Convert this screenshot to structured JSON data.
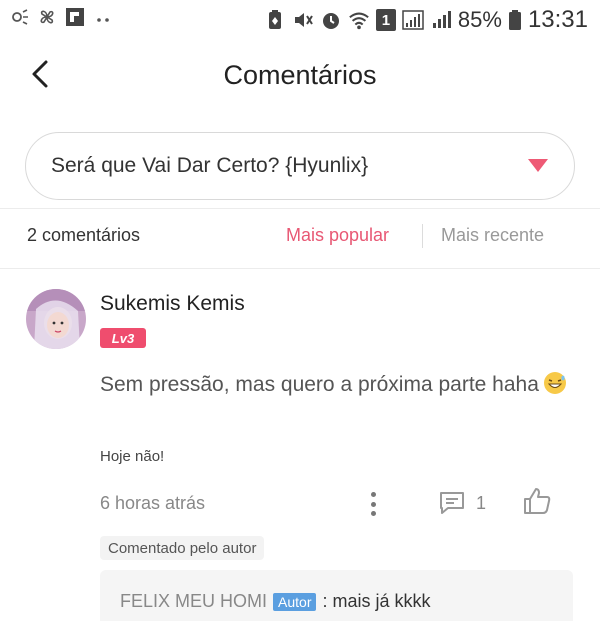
{
  "status_bar": {
    "battery_text": "85%",
    "time": "13:31",
    "sim_slot": "1",
    "icons_left": [
      "notification-icon",
      "pinwheel-icon",
      "flipboard-icon",
      "more-dots-icon"
    ],
    "icons_right": [
      "battery-saver-icon",
      "mute-icon",
      "alarm-icon",
      "wifi-icon",
      "sim-icon",
      "signal-icon",
      "signal-icon",
      "battery-icon"
    ]
  },
  "header": {
    "title": "Comentários",
    "back_icon": "back-arrow-icon"
  },
  "selector": {
    "label": "Será que Vai Dar Certo? {Hyunlix}",
    "caret_color": "#ee5a75"
  },
  "list": {
    "count": "2 comentários",
    "sort_popular": "Mais popular",
    "sort_recent": "Mais recente",
    "active_color": "#e85874"
  },
  "comment": {
    "author": "Sukemis Kemis",
    "level": "Lv3",
    "text": "Sem pressão, mas quero a próxima parte haha",
    "emoji": "grinning-sweat-emoji",
    "signature": "Hoje não!",
    "time_ago": "6 horas atrás",
    "reply_count": "1",
    "author_tag": "Comentado pelo autor",
    "reply": {
      "user": "FELIX MEU HOMI",
      "badge": "Autor",
      "text": ": mais já kkkk"
    }
  }
}
